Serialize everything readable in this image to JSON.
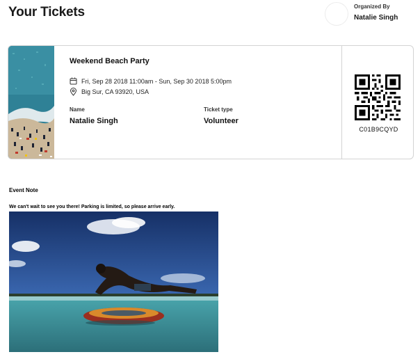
{
  "page": {
    "title": "Your Tickets"
  },
  "organizer": {
    "caption": "Organized By",
    "name": "Natalie Singh"
  },
  "ticket": {
    "event_title": "Weekend Beach Party",
    "date_range": "Fri, Sep 28 2018 11:00am - Sun, Sep 30 2018 5:00pm",
    "location": "Big Sur, CA 93920, USA",
    "name_label": "Name",
    "name_value": "Natalie Singh",
    "type_label": "Ticket type",
    "type_value": "Volunteer",
    "code": "C01B9CQYD"
  },
  "icons": {
    "date": "calendar-icon",
    "location": "map-pin-icon"
  },
  "note": {
    "heading": "Event Note",
    "text": "We can't wait to see you there! Parking is limited, so please arrive early."
  },
  "colors": {
    "card_border": "#d3d3d3",
    "text": "#1e1e1e",
    "ocean": "#2f8a9a",
    "sky": "#1d3a78"
  }
}
